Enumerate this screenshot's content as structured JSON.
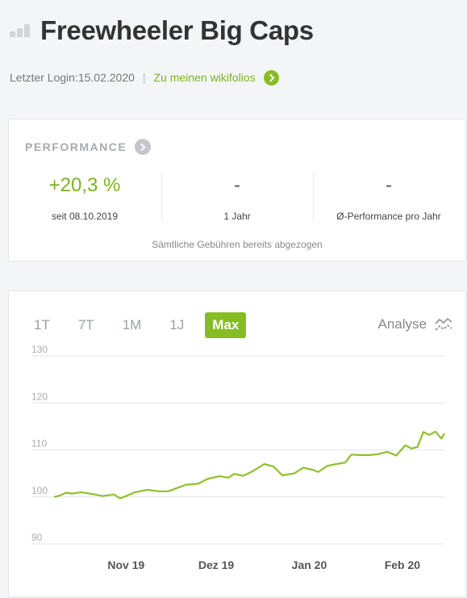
{
  "header": {
    "title": "Freewheeler Big Caps",
    "bars_icon": "bar-chart-icon"
  },
  "subline": {
    "login_text": "Letzter Login:15.02.2020",
    "separator": "|",
    "link_label": "Zu meinen wikifolios",
    "link_icon": "chevron-right-circle-icon"
  },
  "performance": {
    "heading": "PERFORMANCE",
    "heading_icon": "chevron-right-circle-icon",
    "kpis": [
      {
        "value": "+20,3 %",
        "label": "seit 08.10.2019"
      },
      {
        "value": "-",
        "label": "1 Jahr"
      },
      {
        "value": "-",
        "label": "Ø-Performance pro Jahr"
      }
    ],
    "fees_note": "Sämtliche Gebühren bereits abgezogen"
  },
  "chart_controls": {
    "ranges": [
      "1T",
      "7T",
      "1M",
      "1J",
      "Max"
    ],
    "active_range": "Max",
    "analyse_label": "Analyse",
    "analyse_icon": "trend-lines-icon"
  },
  "colors": {
    "accent": "#86bc25",
    "link": "#7ab51d",
    "line": "#8fc02b"
  },
  "chart_data": {
    "type": "line",
    "ylim": [
      90,
      130
    ],
    "yticks": [
      90,
      100,
      110,
      120,
      130
    ],
    "xlabels": [
      {
        "label": "Nov 19",
        "date": "2019-11-01"
      },
      {
        "label": "Dez 19",
        "date": "2019-12-01"
      },
      {
        "label": "Jan 20",
        "date": "2020-01-01"
      },
      {
        "label": "Feb 20",
        "date": "2020-02-01"
      }
    ],
    "xrange": [
      "2019-10-08",
      "2020-02-15"
    ],
    "series": [
      {
        "points": [
          [
            "2019-10-08",
            100.0
          ],
          [
            "2019-10-10",
            100.3
          ],
          [
            "2019-10-12",
            100.9
          ],
          [
            "2019-10-14",
            100.7
          ],
          [
            "2019-10-17",
            101.0
          ],
          [
            "2019-10-21",
            100.6
          ],
          [
            "2019-10-24",
            100.2
          ],
          [
            "2019-10-28",
            100.5
          ],
          [
            "2019-10-30",
            99.7
          ],
          [
            "2019-11-01",
            100.2
          ],
          [
            "2019-11-04",
            101.0
          ],
          [
            "2019-11-08",
            101.5
          ],
          [
            "2019-11-12",
            101.2
          ],
          [
            "2019-11-15",
            101.2
          ],
          [
            "2019-11-18",
            101.9
          ],
          [
            "2019-11-21",
            102.6
          ],
          [
            "2019-11-25",
            102.8
          ],
          [
            "2019-11-28",
            103.8
          ],
          [
            "2019-12-02",
            104.4
          ],
          [
            "2019-12-05",
            104.1
          ],
          [
            "2019-12-07",
            104.9
          ],
          [
            "2019-12-10",
            104.5
          ],
          [
            "2019-12-13",
            105.4
          ],
          [
            "2019-12-17",
            107.0
          ],
          [
            "2019-12-20",
            106.5
          ],
          [
            "2019-12-23",
            104.6
          ],
          [
            "2019-12-27",
            105.0
          ],
          [
            "2019-12-30",
            106.2
          ],
          [
            "2020-01-02",
            105.8
          ],
          [
            "2020-01-04",
            105.3
          ],
          [
            "2020-01-07",
            106.6
          ],
          [
            "2020-01-10",
            107.0
          ],
          [
            "2020-01-13",
            107.3
          ],
          [
            "2020-01-15",
            109.0
          ],
          [
            "2020-01-18",
            108.9
          ],
          [
            "2020-01-21",
            108.9
          ],
          [
            "2020-01-24",
            109.1
          ],
          [
            "2020-01-27",
            109.6
          ],
          [
            "2020-01-30",
            108.8
          ],
          [
            "2020-02-02",
            111.0
          ],
          [
            "2020-02-04",
            110.3
          ],
          [
            "2020-02-06",
            110.6
          ],
          [
            "2020-02-08",
            113.8
          ],
          [
            "2020-02-10",
            113.2
          ],
          [
            "2020-02-12",
            113.9
          ],
          [
            "2020-02-14",
            112.4
          ],
          [
            "2020-02-15",
            113.5
          ]
        ]
      }
    ]
  }
}
